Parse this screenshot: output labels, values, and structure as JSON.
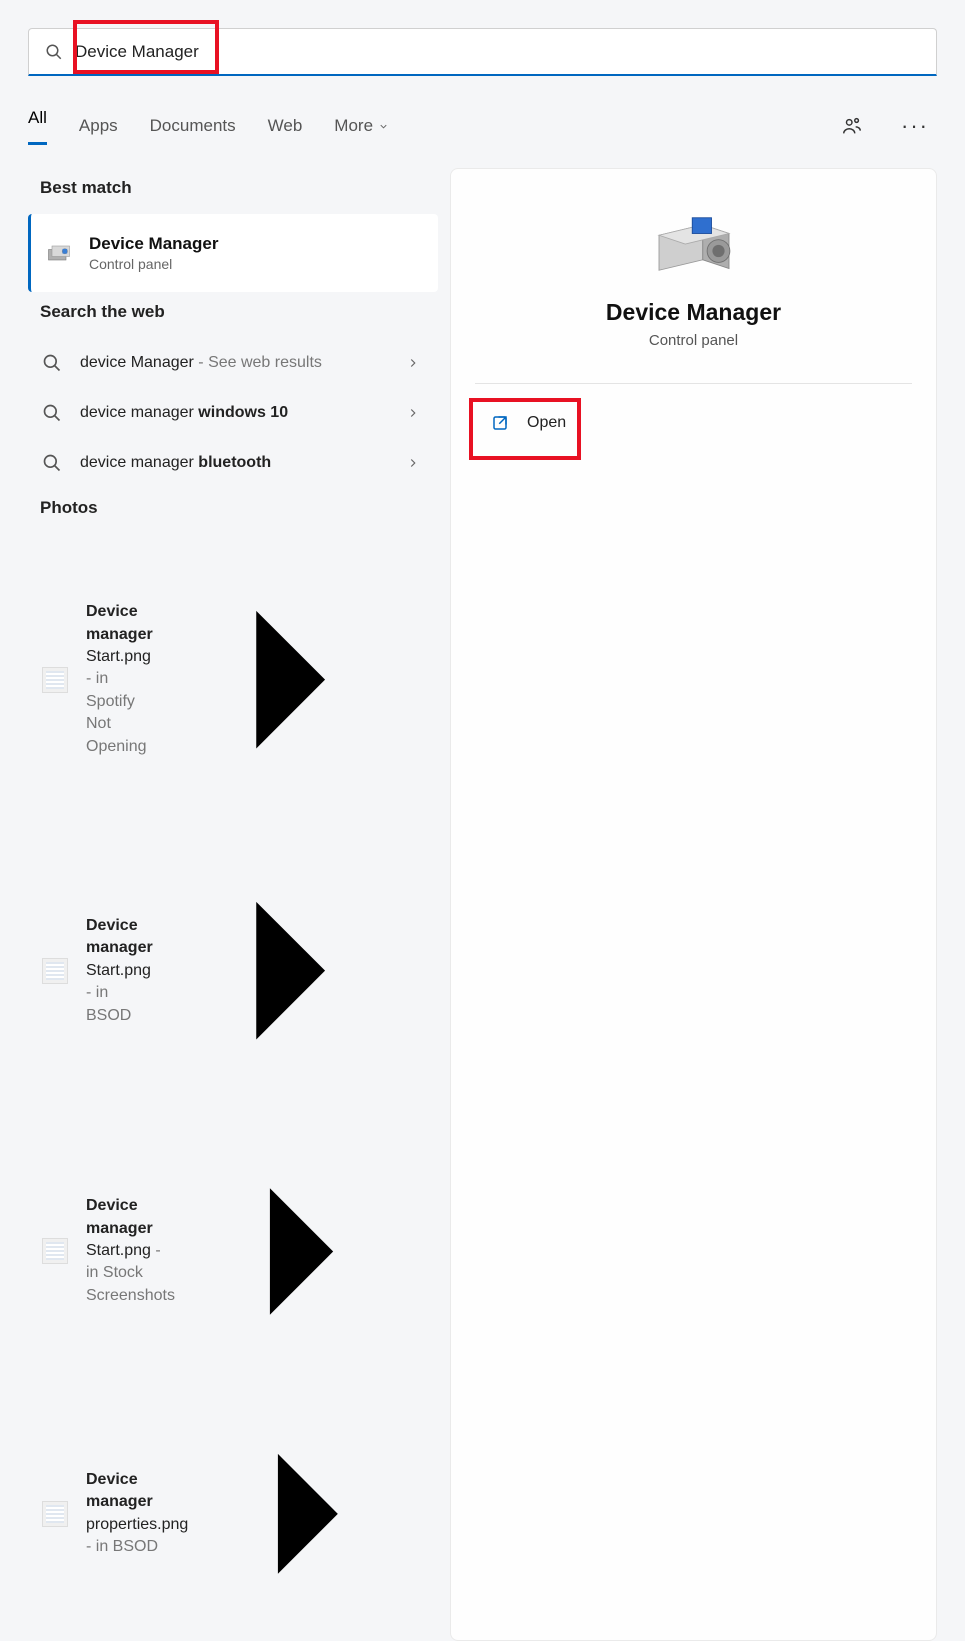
{
  "search": {
    "query": "Device Manager"
  },
  "tabs": {
    "all": "All",
    "apps": "Apps",
    "documents": "Documents",
    "web": "Web",
    "more": "More"
  },
  "sections": {
    "best": "Best match",
    "web": "Search the web",
    "photos": "Photos"
  },
  "best": {
    "title": "Device Manager",
    "subtitle": "Control panel"
  },
  "webResults": [
    {
      "prefix": "device Manager",
      "suffix": " - See web results"
    },
    {
      "prefix": "device manager ",
      "bold": "windows 10"
    },
    {
      "prefix": "device manager ",
      "bold": "bluetooth"
    }
  ],
  "photos": [
    {
      "bold": "Device manager",
      "rest": " Start.png",
      "loc": " - in Spotify Not Opening"
    },
    {
      "bold": "Device manager",
      "rest": " Start.png",
      "loc": " - in BSOD"
    },
    {
      "bold": "Device manager",
      "rest": " Start.png",
      "loc": " - in Stock Screenshots"
    },
    {
      "bold": "Device manager",
      "rest": " properties.png",
      "loc": " - in BSOD"
    }
  ],
  "detail": {
    "title": "Device Manager",
    "subtitle": "Control panel",
    "open": "Open"
  }
}
